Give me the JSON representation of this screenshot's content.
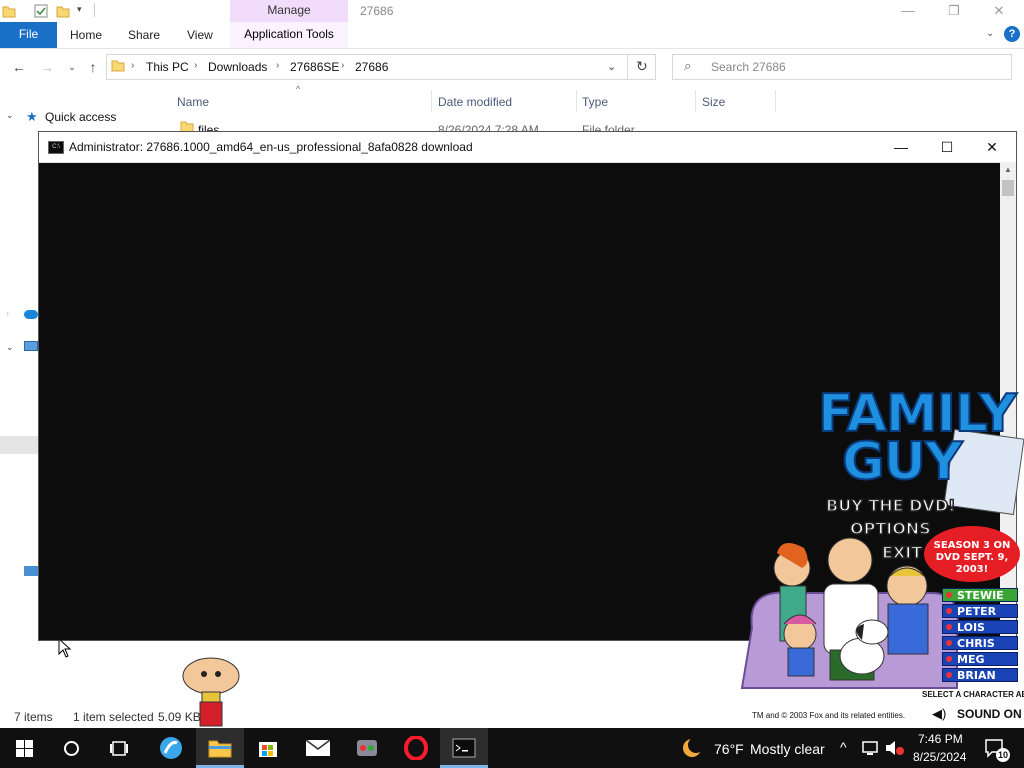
{
  "explorer": {
    "title": "27686",
    "ribbon": {
      "manage_label": "Manage",
      "file_tab": "File",
      "home_tab": "Home",
      "share_tab": "Share",
      "view_tab": "View",
      "app_tools_tab": "Application Tools"
    },
    "breadcrumb": [
      "This PC",
      "Downloads",
      "27686SE",
      "27686"
    ],
    "search_placeholder": "Search 27686",
    "columns": [
      "Name",
      "Date modified",
      "Type",
      "Size"
    ],
    "first_row": {
      "name": "files",
      "date": "8/26/2024 7:28 AM",
      "type": "File folder"
    },
    "navpane": {
      "quick_access": "Quick access"
    },
    "status": {
      "items": "7 items",
      "selected": "1 item selected",
      "size": "5.09 KB"
    }
  },
  "console": {
    "title": "Administrator:  27686.1000_amd64_en-us_professional_8afa0828 download"
  },
  "family_guy": {
    "logo_line1": "FAMILY",
    "logo_line2": "GUY",
    "menu": [
      "BUY THE DVD!",
      "OPTIONS",
      "EXIT"
    ],
    "season_badge": "SEASON 3 ON DVD SEPT. 9, 2003!",
    "characters": [
      "STEWIE",
      "PETER",
      "LOIS",
      "CHRIS",
      "MEG",
      "BRIAN"
    ],
    "select_hint": "SELECT A CHARACTER ABOVE",
    "copyright": "TM and © 2003 Fox and its related entities.",
    "sound_label": "SOUND ON"
  },
  "taskbar": {
    "weather_temp": "76°F",
    "weather_desc": "Mostly clear",
    "time": "7:46 PM",
    "date": "8/25/2024",
    "notification_count": "10"
  },
  "colors": {
    "accent_blue": "#1a6fc7",
    "manage_tab": "#f1dcfb",
    "console_bg": "#0c0c0c",
    "taskbar_bg": "#101010"
  }
}
